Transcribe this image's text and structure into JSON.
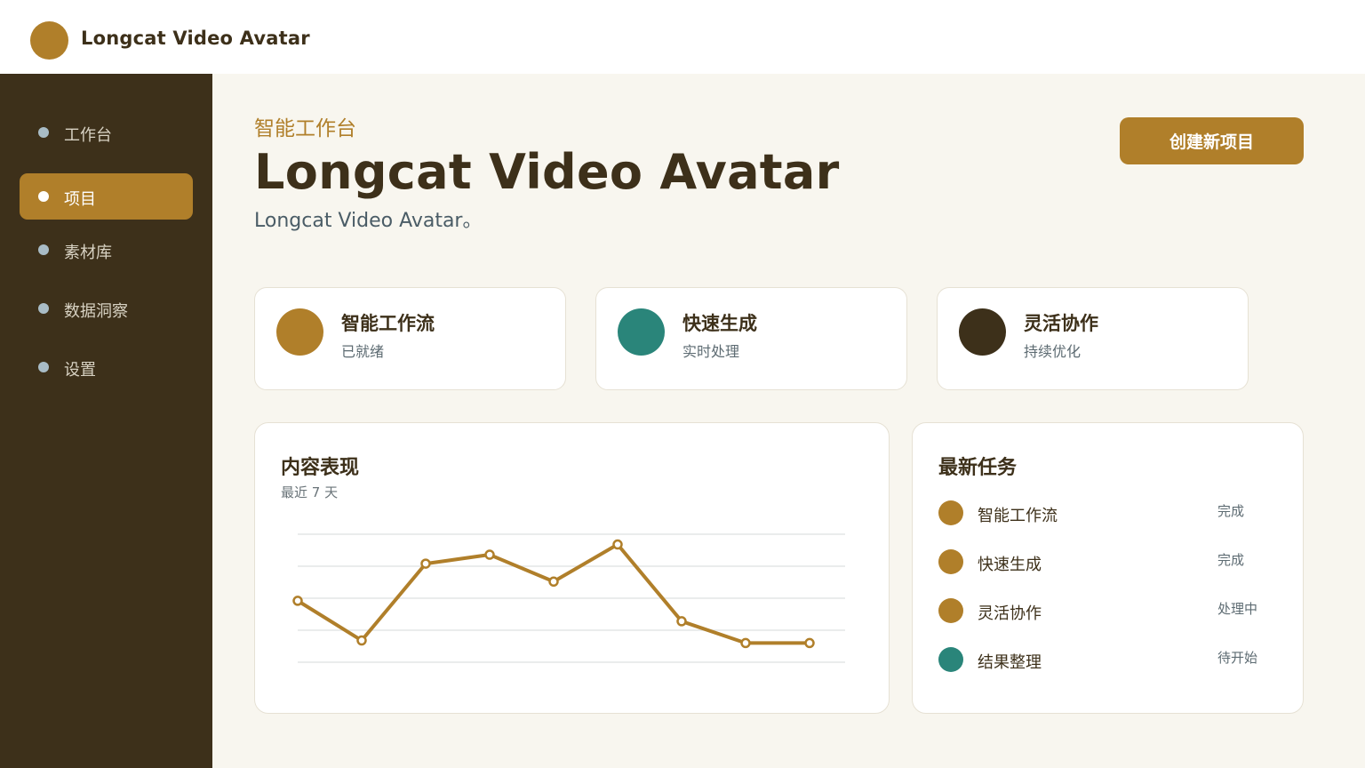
{
  "app": {
    "title": "Longcat Video Avatar"
  },
  "colors": {
    "brand": "#b07f2a",
    "dark": "#3d301a",
    "teal": "#2a857a",
    "sidebar_bg": "#3d301a",
    "page_bg": "#f8f6ef"
  },
  "sidebar": {
    "items": [
      {
        "label": "工作台",
        "active": false
      },
      {
        "label": "项目",
        "active": true
      },
      {
        "label": "素材库",
        "active": false
      },
      {
        "label": "数据洞察",
        "active": false
      },
      {
        "label": "设置",
        "active": false
      }
    ]
  },
  "header": {
    "eyebrow": "智能工作台",
    "title": "Longcat Video Avatar",
    "subtitle": "Longcat Video Avatar。",
    "create_button": "创建新项目"
  },
  "features": [
    {
      "title": "智能工作流",
      "subtitle": "已就绪",
      "color": "#b07f2a"
    },
    {
      "title": "快速生成",
      "subtitle": "实时处理",
      "color": "#2a857a"
    },
    {
      "title": "灵活协作",
      "subtitle": "持续优化",
      "color": "#3d301a"
    }
  ],
  "performance": {
    "title": "内容表现",
    "subtitle": "最近 7 天",
    "chart_data": {
      "type": "line",
      "title": "内容表现",
      "subtitle": "最近 7 天",
      "xlabel": "",
      "ylabel": "",
      "grid": true,
      "ylim": [
        0,
        100
      ],
      "series": [
        {
          "values": [
            48,
            17,
            77,
            84,
            63,
            92,
            32,
            15,
            15
          ],
          "color": "#b07f2a"
        }
      ]
    }
  },
  "tasks": {
    "title": "最新任务",
    "items": [
      {
        "name": "智能工作流",
        "status": "完成",
        "color": "#b07f2a"
      },
      {
        "name": "快速生成",
        "status": "完成",
        "color": "#b07f2a"
      },
      {
        "name": "灵活协作",
        "status": "处理中",
        "color": "#b07f2a"
      },
      {
        "name": "结果整理",
        "status": "待开始",
        "color": "#2a857a"
      }
    ]
  }
}
